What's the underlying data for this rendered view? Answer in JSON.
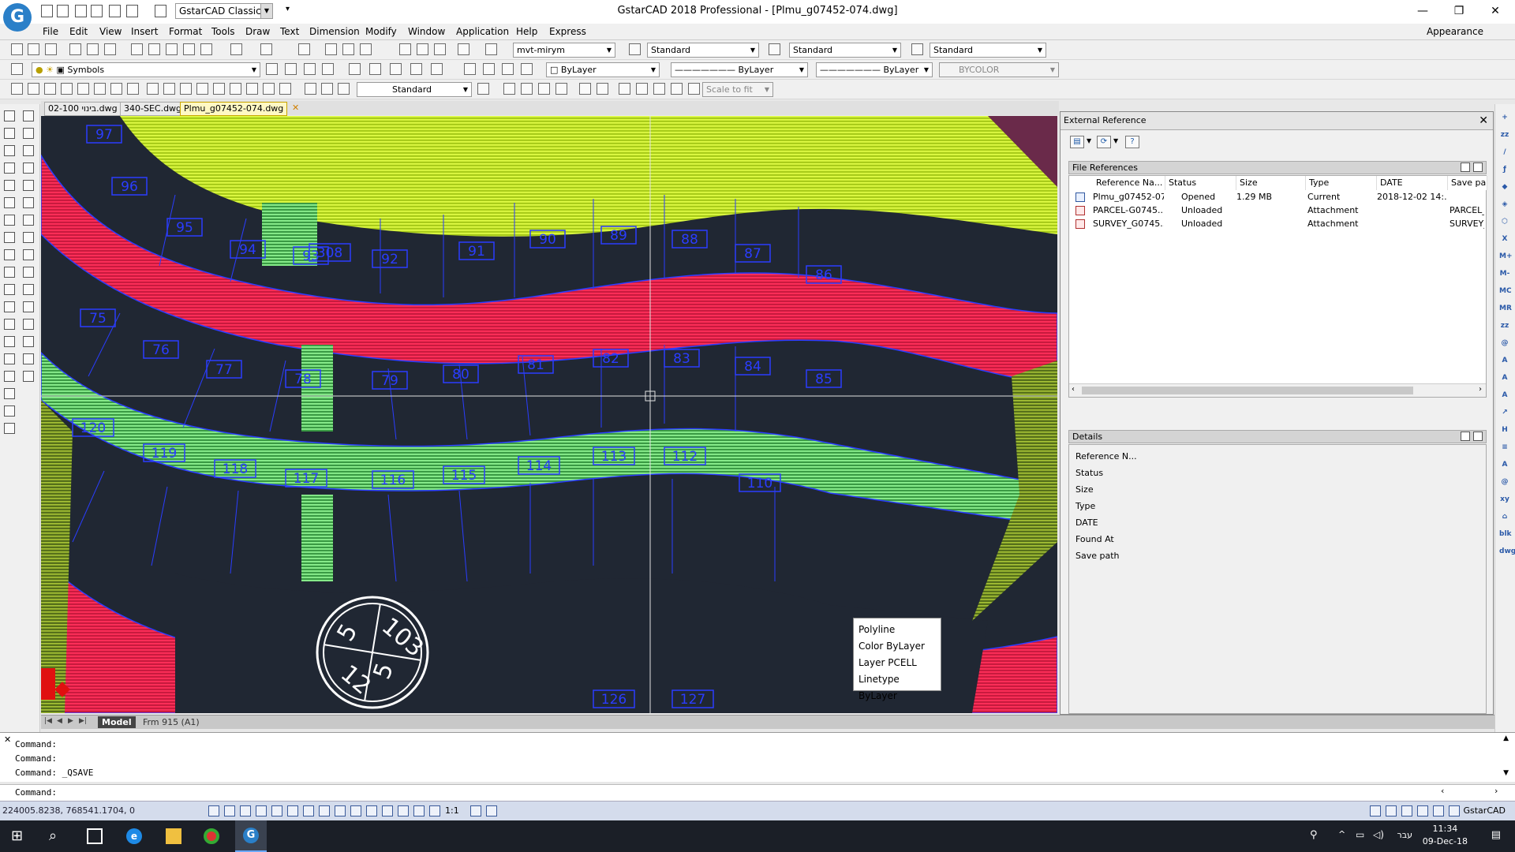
{
  "app": {
    "title": "GstarCAD 2018 Professional - [Plmu_g07452-074.dwg]",
    "logo_letter": "G",
    "workspace": "GstarCAD Classic",
    "appearance": "Appearance",
    "window_buttons": [
      "—",
      "❐",
      "✕"
    ]
  },
  "menubar": [
    "File",
    "Edit",
    "View",
    "Insert",
    "Format",
    "Tools",
    "Draw",
    "Text",
    "Dimension",
    "Modify",
    "Window",
    "Application",
    "Help",
    "Express"
  ],
  "toolbar": {
    "text_style": "mvt-mirym",
    "dim_style": "Standard",
    "table_style": "Standard",
    "mleader_style": "Standard",
    "layer": "Symbols",
    "color": "ByLayer",
    "linetype": "ByLayer",
    "lineweight": "ByLayer",
    "plotstyle": "BYCOLOR",
    "view_style": "Standard",
    "scale": "Scale to fit"
  },
  "doc_tabs": [
    "02-100 בינוי.dwg",
    "340-SEC.dwg",
    "Plmu_g07452-074.dwg"
  ],
  "tab_close": "✕",
  "canvas": {
    "lot_numbers": [
      "97",
      "96",
      "95",
      "94",
      "93",
      "92",
      "91",
      "90",
      "89",
      "88",
      "87",
      "86",
      "75",
      "76",
      "77",
      "78",
      "79",
      "80",
      "81",
      "82",
      "83",
      "84",
      "85",
      "120",
      "119",
      "118",
      "117",
      "116",
      "115",
      "114",
      "113",
      "112",
      "110",
      "126",
      "127",
      "308"
    ],
    "stamp": [
      "5",
      "103",
      "12",
      "5"
    ]
  },
  "tooltip": {
    "title": "Polyline",
    "color": "Color  ByLayer",
    "layer": "Layer  PCELL",
    "linetype": "Linetype  ByLayer"
  },
  "layout_tabs": {
    "model": "Model",
    "sheet": "Frm 915 (A1)"
  },
  "xref": {
    "title": "External Reference",
    "close": "✕",
    "file_references_label": "File References",
    "columns": [
      "Reference Na...",
      "Status",
      "Size",
      "Type",
      "DATE",
      "Save pa"
    ],
    "rows": [
      {
        "name": "Plmu_g07452-074",
        "status": "Opened",
        "size": "1.29 MB",
        "type": "Current",
        "date": "2018-12-02 14:...",
        "save": ""
      },
      {
        "name": "PARCEL-G0745...",
        "status": "Unloaded",
        "size": "",
        "type": "Attachment",
        "date": "",
        "save": "PARCEL_"
      },
      {
        "name": "SURVEY_G0745...",
        "status": "Unloaded",
        "size": "",
        "type": "Attachment",
        "date": "",
        "save": "SURVEY_"
      }
    ],
    "details_label": "Details",
    "details_fields": [
      "Reference N...",
      "Status",
      "Size",
      "Type",
      "DATE",
      "Found At",
      "Save path"
    ]
  },
  "command": {
    "history": [
      "Command:",
      "Command:",
      "Command: _QSAVE"
    ],
    "prompt": "Command:"
  },
  "status": {
    "coords": "224005.8238, 768541.1704, 0",
    "annotation_scale": "1:1",
    "app_label": "GstarCAD"
  },
  "taskbar": {
    "time": "11:34",
    "date": "09-Dec-18",
    "lang": "עבר"
  },
  "colors": {
    "canvas_bg": "#202733",
    "road": "#e8224f",
    "green_strip": "#c8f030",
    "light_green": "#6ee07a",
    "lot_text": "#2a3dff",
    "accent": "#2a7fc8"
  }
}
